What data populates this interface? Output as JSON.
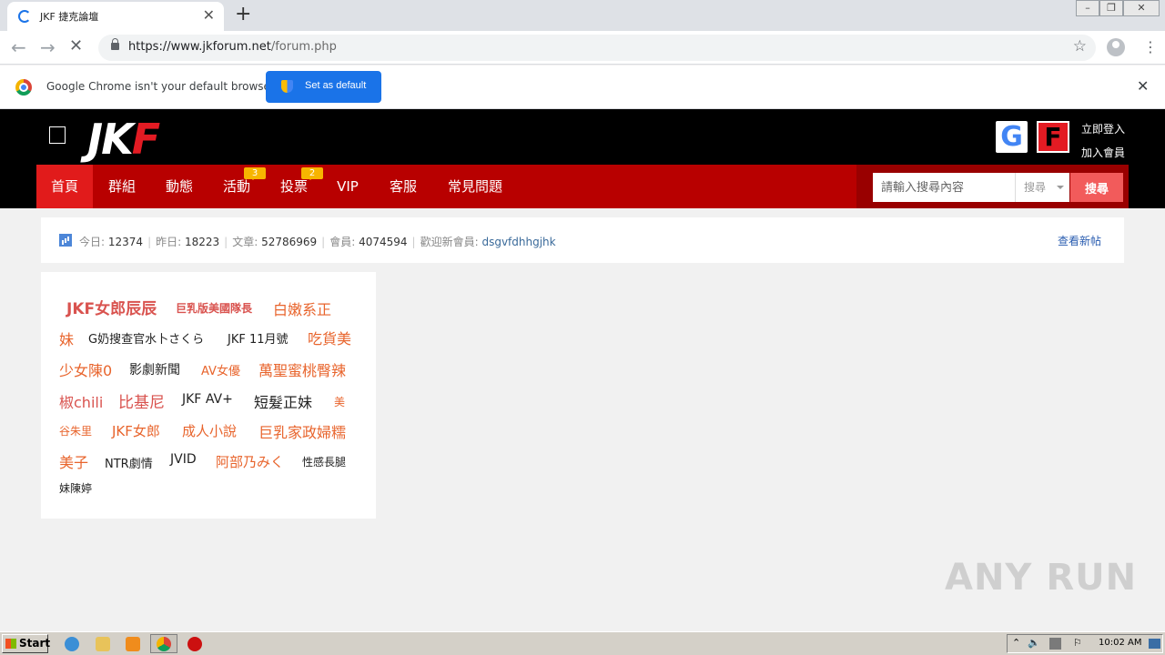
{
  "browser": {
    "tab_title": "JKF 捷克論壇",
    "url_host": "https://www.jkforum.net",
    "url_path": "/forum.php",
    "new_tab": "+",
    "tab_close": "✕",
    "infobar_text": "Google Chrome isn't your default browser",
    "set_default_label": "Set as default",
    "infobar_close": "✕"
  },
  "header": {
    "logo_main": "JK",
    "logo_accent": "F",
    "google_letter": "G",
    "facebook_letter": "F",
    "login": "立即登入",
    "register": "加入會員"
  },
  "nav": {
    "items": [
      {
        "label": "首頁"
      },
      {
        "label": "群組"
      },
      {
        "label": "動態"
      },
      {
        "label": "活動",
        "badge": "3"
      },
      {
        "label": "投票",
        "badge": "2"
      },
      {
        "label": "VIP"
      },
      {
        "label": "客服"
      },
      {
        "label": "常見問題"
      }
    ],
    "search_placeholder": "請輸入搜尋內容",
    "search_select": "搜尋",
    "search_button": "搜尋"
  },
  "stats": {
    "today_label": "今日:",
    "today": "12374",
    "yesterday_label": "昨日:",
    "yesterday": "18223",
    "posts_label": "文章:",
    "posts": "52786969",
    "members_label": "會員:",
    "members": "4074594",
    "welcome_label": "歡迎新會員:",
    "newest_member": "dsgvfdhhgjhk",
    "view_new": "查看新帖"
  },
  "tags": [
    "JKF女郎辰辰",
    "巨乳版美國隊長",
    "白嫩系正",
    "妹",
    "G奶搜查官水卜さくら",
    "JKF 11月號",
    "吃貨美",
    "少女陳0",
    "影劇新聞",
    "AV女優",
    "萬聖蜜桃臀辣",
    "椒chili",
    "比基尼",
    "JKF AV+",
    "短髮正妹",
    "美",
    "谷朱里",
    "JKF女郎",
    "成人小說",
    "巨乳家政婦糯",
    "美子",
    "NTR劇情",
    "JVID",
    "阿部乃みく",
    "性感長腿",
    "妹陳婷"
  ],
  "watermark": "ANY RUN",
  "taskbar": {
    "start": "Start",
    "clock": "10:02 AM"
  },
  "colors": {
    "nav_red": "#b80000",
    "nav_active": "#e11b1b",
    "badge": "#f7b500",
    "tag_red": "#d9534f",
    "tag_orange": "#e8642c"
  }
}
